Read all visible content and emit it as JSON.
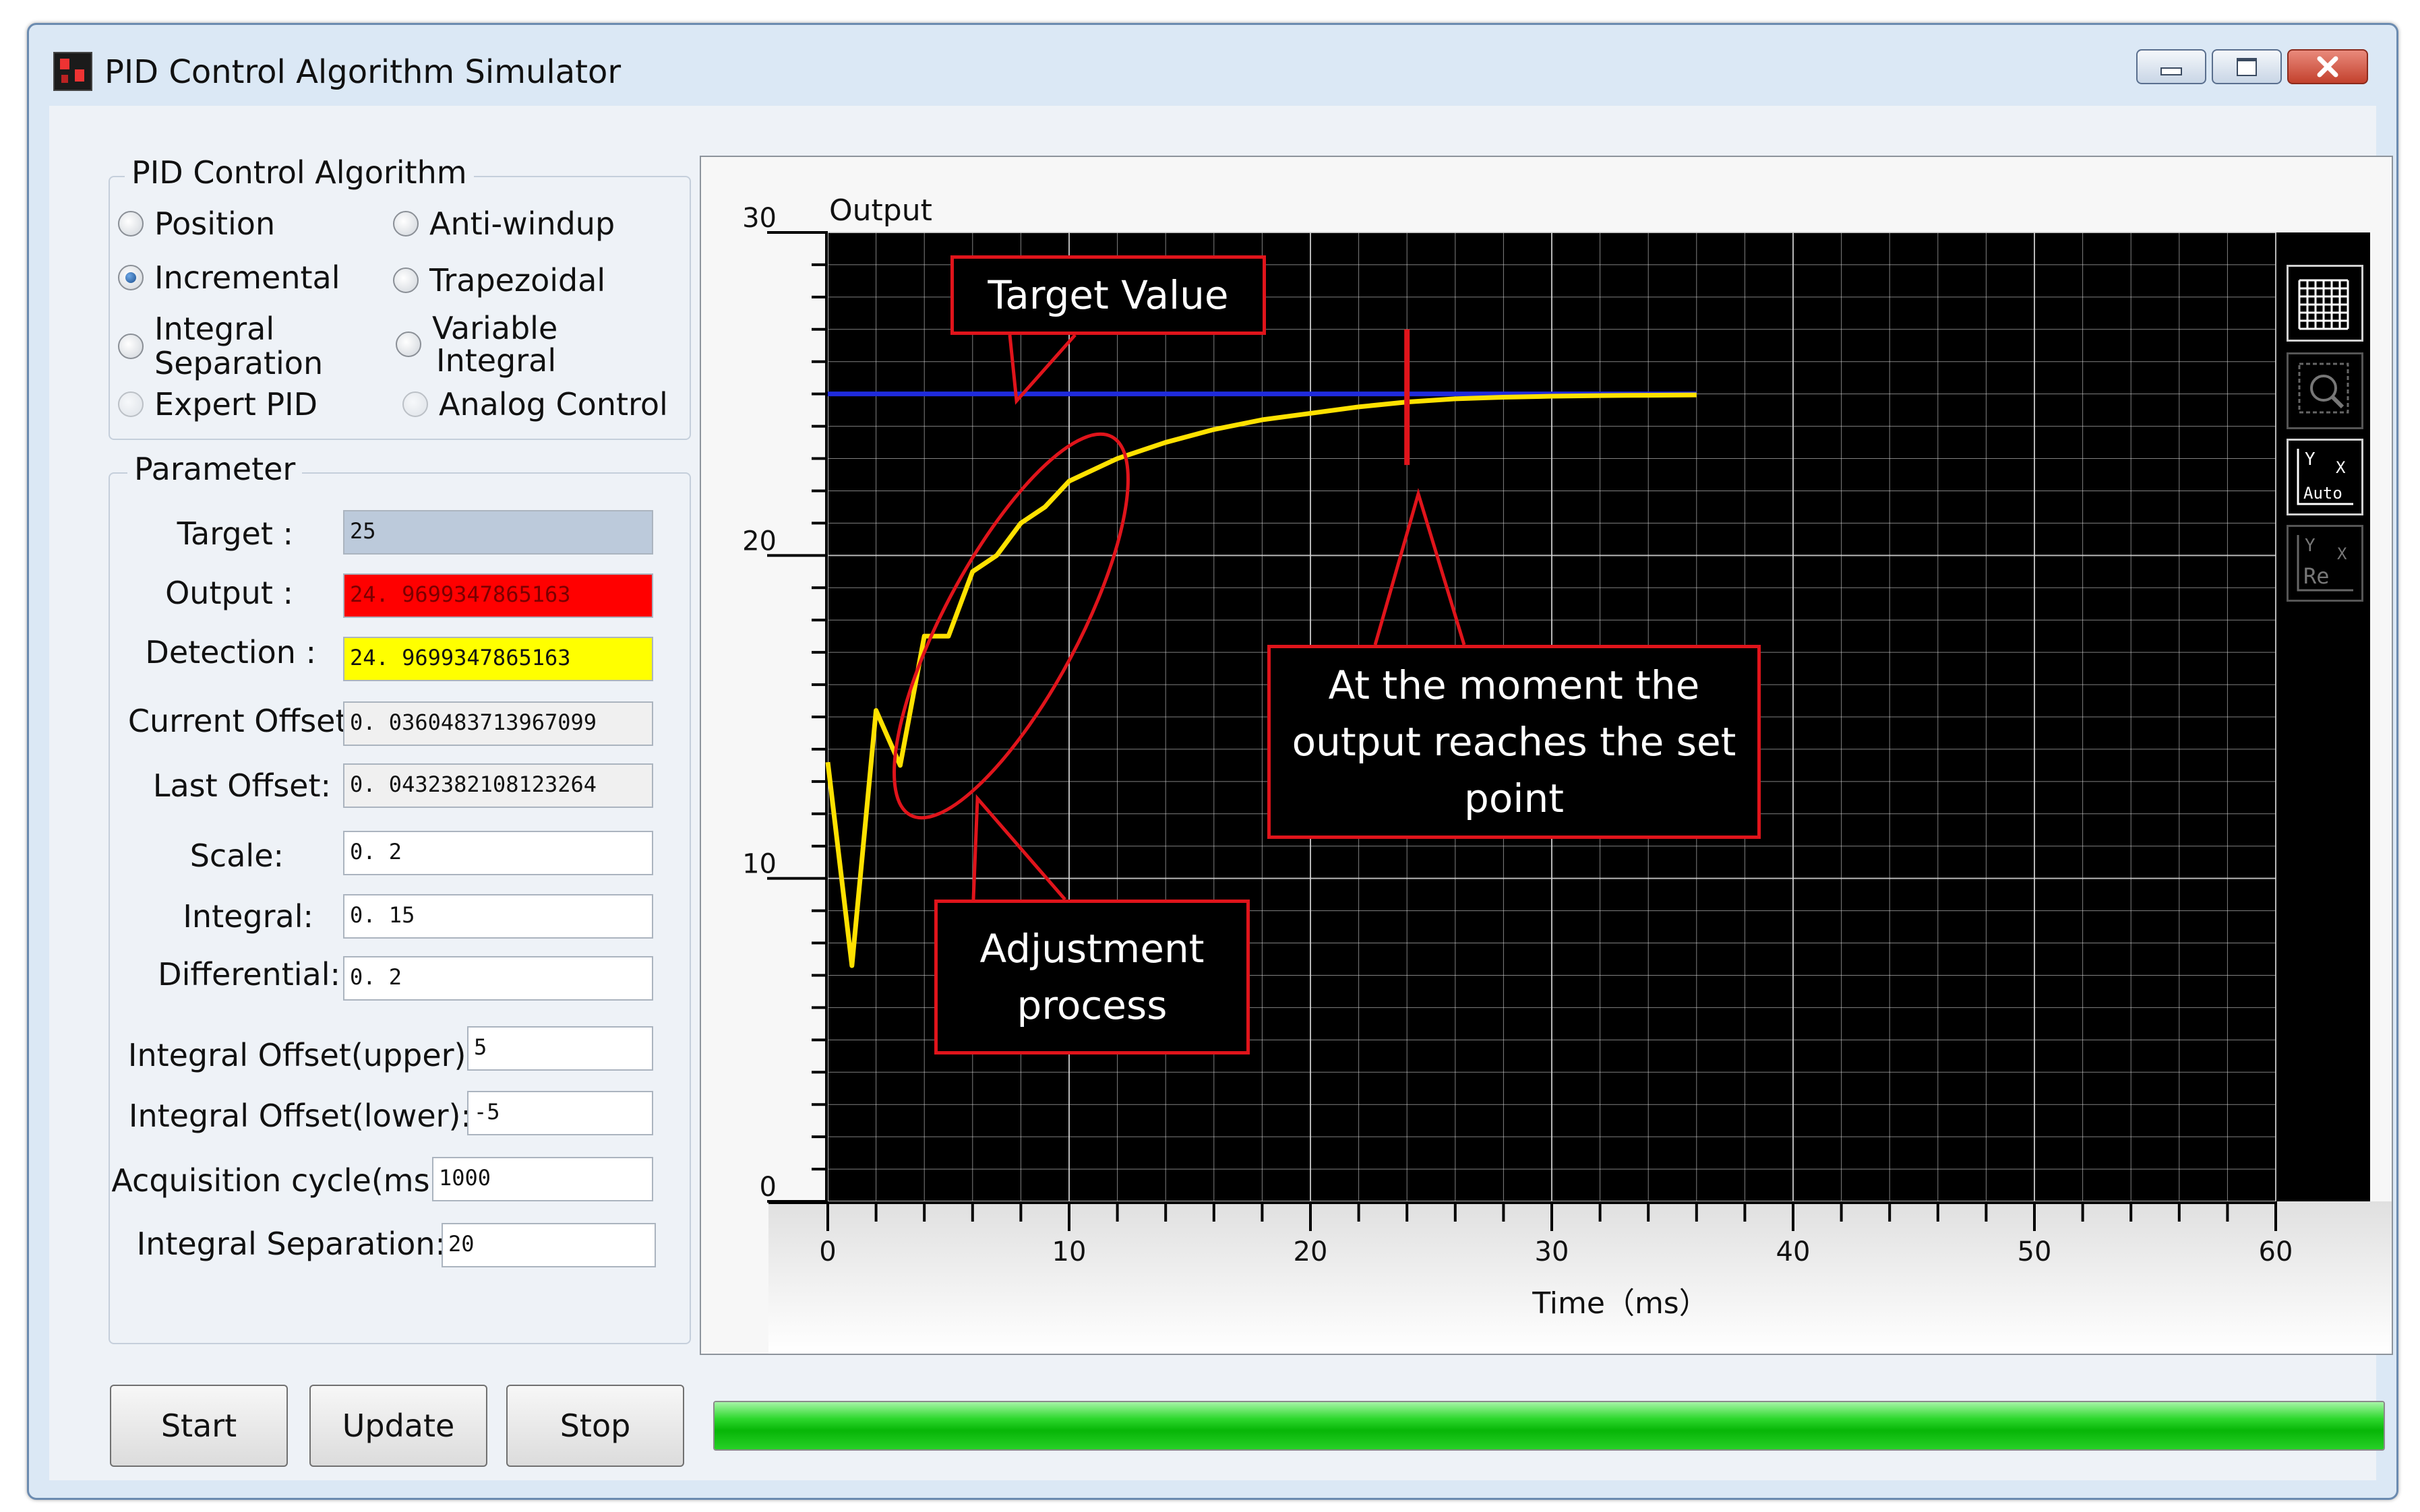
{
  "window": {
    "title": "PID Control Algorithm Simulator"
  },
  "algorithm_group": {
    "legend": "PID Control Algorithm",
    "options": [
      {
        "line1": "Position",
        "line2": "",
        "checked": false,
        "disabled": false
      },
      {
        "line1": "Anti-windup",
        "line2": "",
        "checked": false,
        "disabled": false
      },
      {
        "line1": "Incremental",
        "line2": "",
        "checked": true,
        "disabled": false
      },
      {
        "line1": "Trapezoidal",
        "line2": "",
        "checked": false,
        "disabled": false
      },
      {
        "line1": "Integral",
        "line2": "Separation",
        "checked": false,
        "disabled": false
      },
      {
        "line1": "Variable",
        "line2": "Integral",
        "checked": false,
        "disabled": false
      },
      {
        "line1": "Expert PID",
        "line2": "",
        "checked": false,
        "disabled": true
      },
      {
        "line1": "Analog Control",
        "line2": "",
        "checked": false,
        "disabled": true
      }
    ]
  },
  "parameter_group": {
    "legend": "Parameter",
    "target": {
      "label": "Target :",
      "value": "25"
    },
    "output": {
      "label": "Output :",
      "value": "24. 9699347865163"
    },
    "detection": {
      "label": "Detection :",
      "value": "24. 9699347865163"
    },
    "current_offset": {
      "label": "Current Offset:",
      "value": "0. 0360483713967099"
    },
    "last_offset": {
      "label": "Last Offset:",
      "value": "0. 0432382108123264"
    },
    "scale": {
      "label": "Scale:",
      "value": "0. 2"
    },
    "integral": {
      "label": "Integral:",
      "value": "0. 15"
    },
    "differential": {
      "label": "Differential:",
      "value": "0. 2"
    },
    "integral_offset_upper": {
      "label": "Integral Offset(upper):",
      "value": "5"
    },
    "integral_offset_lower": {
      "label": "Integral Offset(lower):",
      "value": "-5"
    },
    "acquisition_cycle": {
      "label": "Acquisition cycle(ms):",
      "value": "1000"
    },
    "integral_separation": {
      "label": "Integral Separation:",
      "value": "20"
    }
  },
  "buttons": {
    "start": "Start",
    "update": "Update",
    "stop": "Stop"
  },
  "progress": {
    "fraction": 1.0
  },
  "colors": {
    "plot_bg": "#000000",
    "grid": "#d8d8d8",
    "target_line": "#1f2bdc",
    "output_line": "#ffe100",
    "annotation": "#e0141b",
    "target_field": "#bccadb",
    "output_field": "#ff0000",
    "detection_field": "#ffff00"
  },
  "chart_data": {
    "type": "line",
    "title": "",
    "ylabel": "Output",
    "xlabel": "Time（ms）",
    "xlim": [
      0,
      60
    ],
    "ylim": [
      0,
      30
    ],
    "x_ticks": [
      "0",
      "10",
      "20",
      "30",
      "40",
      "50",
      "60"
    ],
    "y_ticks": [
      "0",
      "10",
      "20",
      "30"
    ],
    "grid": true,
    "series": [
      {
        "color": "#1f2bdc",
        "x": [
          0,
          36
        ],
        "y": [
          25,
          25
        ]
      },
      {
        "color": "#ffe100",
        "x": [
          0,
          1,
          2,
          3,
          4,
          5,
          6,
          7,
          8,
          9,
          10,
          12,
          14,
          16,
          18,
          20,
          22,
          24,
          26,
          28,
          30,
          32,
          34,
          36
        ],
        "y": [
          13.6,
          7.3,
          15.2,
          13.5,
          17.5,
          17.5,
          19.5,
          20.0,
          21.0,
          21.5,
          22.3,
          23.0,
          23.5,
          23.9,
          24.2,
          24.4,
          24.6,
          24.75,
          24.85,
          24.9,
          24.93,
          24.95,
          24.96,
          24.97
        ]
      }
    ],
    "annotations": [
      {
        "text": "Target  Value"
      },
      {
        "text": "At the moment the output reaches the set point"
      },
      {
        "text": "Adjustment process"
      }
    ],
    "tools": [
      "grid-icon",
      "zoom-icon",
      "y-auto-icon",
      "y-reset-icon"
    ],
    "tool_labels": {
      "auto": "Auto",
      "reset": "Re",
      "y": "Y",
      "x": "X"
    }
  }
}
